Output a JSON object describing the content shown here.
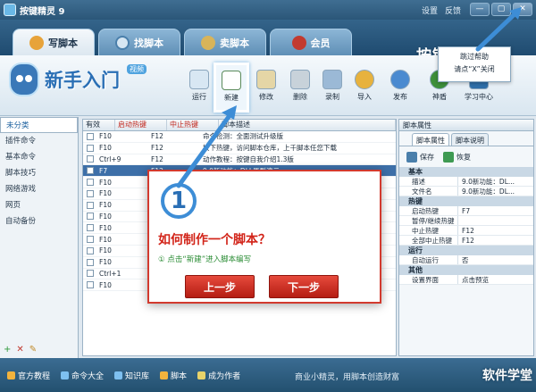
{
  "window": {
    "title": "按键精灵 9",
    "links": [
      "设置",
      "反馈"
    ],
    "buttons": [
      "—",
      "▢",
      "✕"
    ]
  },
  "tabs": [
    {
      "label": "写脚本",
      "icon": "pen-icon"
    },
    {
      "label": "找脚本",
      "icon": "search-icon"
    },
    {
      "label": "卖脚本",
      "icon": "money-bag-icon"
    },
    {
      "label": "会员",
      "icon": "member-icon"
    }
  ],
  "logo": "按键精灵",
  "brand": {
    "text": "新手入门",
    "badge": "视频"
  },
  "toolbar": [
    {
      "label": "运行",
      "icon": "run-icon"
    },
    {
      "label": "新建",
      "icon": "new-file-icon"
    },
    {
      "label": "修改",
      "icon": "edit-icon"
    },
    {
      "label": "删除",
      "icon": "delete-icon"
    },
    {
      "label": "录制",
      "icon": "record-icon"
    },
    {
      "label": "导入",
      "icon": "import-icon"
    },
    {
      "label": "发布",
      "icon": "publish-icon"
    },
    {
      "label": "神盾",
      "icon": "shield-icon"
    },
    {
      "label": "学习中心",
      "icon": "learning-icon"
    }
  ],
  "sidebar": [
    "未分类",
    "插件命令",
    "基本命令",
    "脚本技巧",
    "网络游戏",
    "网页",
    "自动备份"
  ],
  "sidebar_footer": [
    "+",
    "✕",
    "✎"
  ],
  "table": {
    "headers": [
      "有效",
      "启动热键",
      "中止热键",
      "脚本描述"
    ],
    "rows": [
      {
        "start": "F10",
        "stop": "F12",
        "desc": "命令检测：全面测试升级版"
      },
      {
        "start": "F10",
        "stop": "F12",
        "desc": "按下热键，访问脚本仓库，上千脚本任您下载"
      },
      {
        "start": "Ctrl+9",
        "stop": "F12",
        "desc": "动作教程：按键自我介绍1.3版"
      },
      {
        "start": "F7",
        "stop": "F12",
        "desc": "9.0新功能：DLL原型演示",
        "selected": true
      },
      {
        "start": "F10",
        "stop": "F12",
        "desc": ""
      },
      {
        "start": "F10",
        "stop": "",
        "desc": ""
      },
      {
        "start": "F10",
        "stop": "",
        "desc": ""
      },
      {
        "start": "F10",
        "stop": "",
        "desc": ""
      },
      {
        "start": "F10",
        "stop": "",
        "desc": ""
      },
      {
        "start": "F10",
        "stop": "",
        "desc": ""
      },
      {
        "start": "F10",
        "stop": "",
        "desc": ""
      },
      {
        "start": "F10",
        "stop": "",
        "desc": ""
      },
      {
        "start": "Ctrl+1",
        "stop": "",
        "desc": ""
      },
      {
        "start": "F10",
        "stop": "",
        "desc": ""
      }
    ]
  },
  "props": {
    "title": "脚本属性",
    "tabs": [
      "脚本属性",
      "脚本说明"
    ],
    "actions": [
      "保存",
      "恢复"
    ],
    "groups": [
      {
        "name": "基本",
        "rows": [
          [
            "描述",
            "9.0新功能：DL..."
          ],
          [
            "文件名",
            "9.0新功能：DL..."
          ]
        ]
      },
      {
        "name": "热键",
        "rows": [
          [
            "启动热键",
            "F7"
          ],
          [
            "暂停/继续热键",
            ""
          ],
          [
            "中止热键",
            "F12"
          ],
          [
            "全部中止热键",
            "F12"
          ]
        ]
      },
      {
        "name": "运行",
        "rows": [
          [
            "自动运行",
            "否"
          ]
        ]
      },
      {
        "name": "其他",
        "rows": [
          [
            "设置界面",
            "点击预览"
          ]
        ]
      }
    ]
  },
  "status": {
    "items": [
      "官方教程",
      "命令大全",
      "知识库",
      "脚本",
      "成为作者"
    ],
    "slogan": "商业小精灵，用脚本创造财富"
  },
  "dialog": {
    "step": "1",
    "title": "如何制作一个脚本？",
    "hint": "① 点击“新建”进入脚本编写",
    "prev": "上一步",
    "next": "下一步"
  },
  "tooltip": {
    "line1": "跳过帮助",
    "line2": "请点“X”关闭"
  },
  "watermark": "软件学堂",
  "colors": {
    "accent_red": "#d22419",
    "highlight_blue": "#3d8dd6",
    "header_blue": "#2b5678"
  }
}
